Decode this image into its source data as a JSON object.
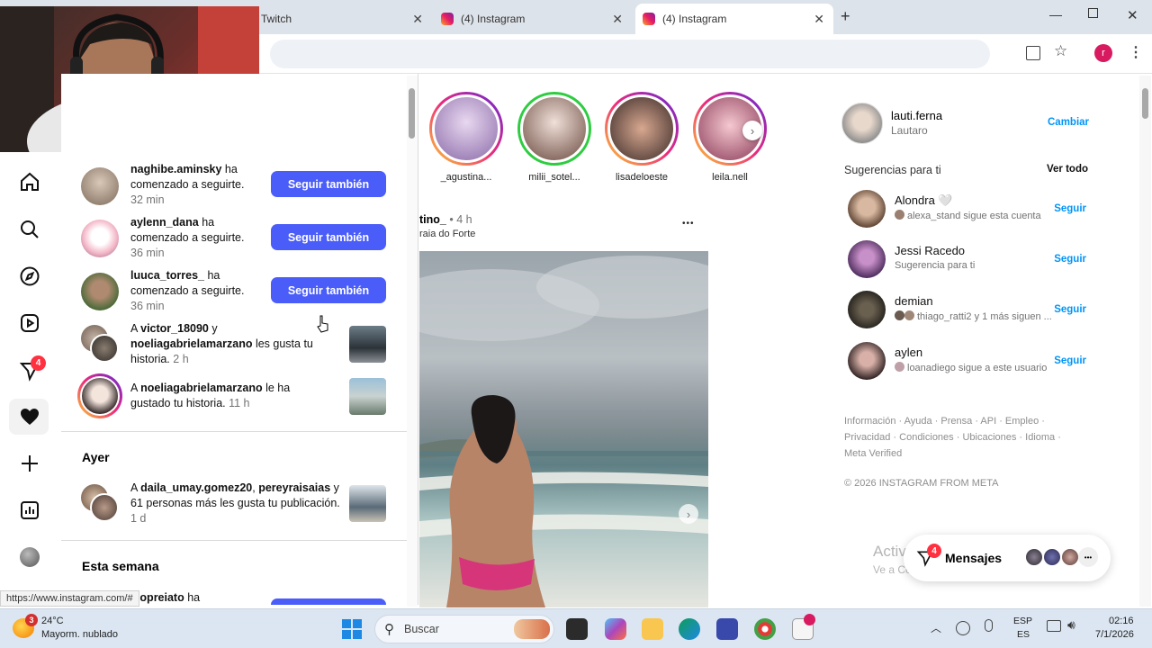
{
  "browser": {
    "tabs": [
      {
        "label": "Twitch"
      },
      {
        "label": "(4) Instagram"
      },
      {
        "label": "(4) Instagram"
      }
    ],
    "new_tab": "+",
    "profile_initial": "r",
    "status_url": "https://www.instagram.com/#"
  },
  "nav": {
    "badge_count": "4"
  },
  "notifications": {
    "follow_rows": [
      {
        "user": "naghibe.aminsky",
        "text": " ha comenzado a seguirte.",
        "time": "32 min",
        "button": "Seguir también"
      },
      {
        "user": "aylenn_dana",
        "text": " ha comenzado a seguirte.",
        "time": "36 min",
        "button": "Seguir también"
      },
      {
        "user": "luuca_torres_",
        "text": " ha comenzado a seguirte.",
        "time": "36 min",
        "button": "Seguir también"
      }
    ],
    "like_rows": [
      {
        "prefix": "A ",
        "user1": "victor_18090",
        "mid": " y ",
        "user2": "noeliagabrielamarzano",
        "text": " les gusta tu historia.",
        "time": "2 h"
      },
      {
        "prefix": "A ",
        "user1": "noeliagabrielamarzano",
        "text": " le ha gustado tu historia.",
        "time": "11 h"
      }
    ],
    "section_yesterday": "Ayer",
    "yesterday_row": {
      "prefix": "A ",
      "user1": "daila_umay.gomez20",
      "mid": ", ",
      "user2": "pereyraisaias",
      "text": " y 61 personas más les gusta tu publicación.",
      "time": "1 d"
    },
    "section_week": "Esta semana",
    "week_row": {
      "user": "alopreiato",
      "text": " ha"
    }
  },
  "stories": [
    {
      "name": "_agustina..."
    },
    {
      "name": "milii_sotel..."
    },
    {
      "name": "lisadeloeste"
    },
    {
      "name": "leila.nell"
    }
  ],
  "post": {
    "user_partial": "tino_",
    "time": "• 4 h",
    "location_partial": "raia do Forte",
    "more": "•••"
  },
  "sidebar": {
    "me": {
      "username": "lauti.ferna",
      "name": "Lautaro",
      "action": "Cambiar"
    },
    "suggestions_title": "Sugerencias para ti",
    "see_all": "Ver todo",
    "suggestions": [
      {
        "name": "Alondra 🤍",
        "sub": "alexa_stand sigue esta cuenta",
        "action": "Seguir"
      },
      {
        "name": "Jessi Racedo",
        "sub": "Sugerencia para ti",
        "action": "Seguir"
      },
      {
        "name": "demian",
        "sub": "thiago_ratti2 y 1 más siguen ...",
        "action": "Seguir"
      },
      {
        "name": "aylen",
        "sub": "loanadiego sigue a este usuario",
        "action": "Seguir"
      }
    ],
    "footer_line1": "Información · Ayuda · Prensa · API · Empleo ·",
    "footer_line2": "Privacidad · Condiciones · Ubicaciones · Idioma ·",
    "footer_line3": "Meta Verified",
    "copyright": "© 2026 INSTAGRAM FROM META"
  },
  "messages": {
    "label": "Mensajes",
    "badge": "4",
    "more": "•••"
  },
  "watermark": {
    "line1": "Activar Windows",
    "line2": "Ve a Configuración para activar Windows."
  },
  "taskbar": {
    "weather_badge": "3",
    "temp": "24°C",
    "weather": "Mayorm. nublado",
    "search": "Buscar",
    "lang1": "ESP",
    "lang2": "ES",
    "time": "02:16",
    "date": "7/1/2026"
  },
  "colors": {
    "accent": "#4a5df9",
    "link": "#0095f6",
    "badge": "#ff3040"
  }
}
